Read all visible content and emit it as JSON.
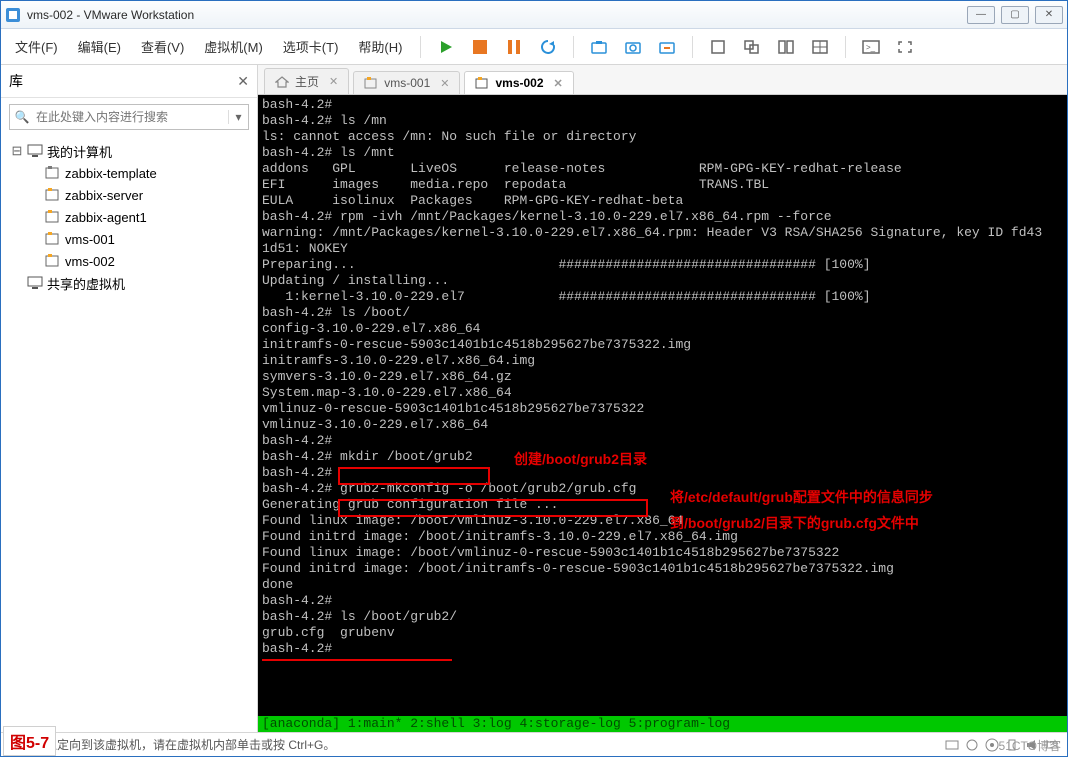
{
  "window": {
    "title": "vms-002 - VMware Workstation"
  },
  "menu": {
    "file": "文件(F)",
    "edit": "编辑(E)",
    "view": "查看(V)",
    "vm": "虚拟机(M)",
    "tabs": "选项卡(T)",
    "help": "帮助(H)"
  },
  "sidebar": {
    "lib_title": "库",
    "search_placeholder": "在此处键入内容进行搜索",
    "root": "我的计算机",
    "items": [
      {
        "label": "zabbix-template",
        "state": "off"
      },
      {
        "label": "zabbix-server",
        "state": "on"
      },
      {
        "label": "zabbix-agent1",
        "state": "on"
      },
      {
        "label": "vms-001",
        "state": "on"
      },
      {
        "label": "vms-002",
        "state": "on"
      }
    ],
    "shared": "共享的虚拟机"
  },
  "tabs": {
    "home": "主页",
    "t1": "vms-001",
    "t2": "vms-002"
  },
  "terminal": {
    "body": "bash-4.2#\nbash-4.2# ls /mn\nls: cannot access /mn: No such file or directory\nbash-4.2# ls /mnt\naddons   GPL       LiveOS      release-notes            RPM-GPG-KEY-redhat-release\nEFI      images    media.repo  repodata                 TRANS.TBL\nEULA     isolinux  Packages    RPM-GPG-KEY-redhat-beta\nbash-4.2# rpm -ivh /mnt/Packages/kernel-3.10.0-229.el7.x86_64.rpm --force\nwarning: /mnt/Packages/kernel-3.10.0-229.el7.x86_64.rpm: Header V3 RSA/SHA256 Signature, key ID fd43\n1d51: NOKEY\nPreparing...                          ################################# [100%]\nUpdating / installing...\n   1:kernel-3.10.0-229.el7            ################################# [100%]\nbash-4.2# ls /boot/\nconfig-3.10.0-229.el7.x86_64\ninitramfs-0-rescue-5903c1401b1c4518b295627be7375322.img\ninitramfs-3.10.0-229.el7.x86_64.img\nsymvers-3.10.0-229.el7.x86_64.gz\nSystem.map-3.10.0-229.el7.x86_64\nvmlinuz-0-rescue-5903c1401b1c4518b295627be7375322\nvmlinuz-3.10.0-229.el7.x86_64\nbash-4.2#\nbash-4.2# mkdir /boot/grub2\nbash-4.2#\nbash-4.2# grub2-mkconfig -o /boot/grub2/grub.cfg\nGenerating grub configuration file ...\nFound linux image: /boot/vmlinuz-3.10.0-229.el7.x86_64\nFound initrd image: /boot/initramfs-3.10.0-229.el7.x86_64.img\nFound linux image: /boot/vmlinuz-0-rescue-5903c1401b1c4518b295627be7375322\nFound initrd image: /boot/initramfs-0-rescue-5903c1401b1c4518b295627be7375322.img\ndone\nbash-4.2#\nbash-4.2# ls /boot/grub2/\ngrub.cfg  grubenv\nbash-4.2#",
    "status": "[anaconda] 1:main* 2:shell  3:log  4:storage-log  5:program-log"
  },
  "annotations": {
    "label1": "创建/boot/grub2目录",
    "label2a": "将/etc/default/grub配置文件中的信息同步",
    "label2b": "到/boot/grub2/目录下的grub.cfg文件中",
    "fig": "图5-7"
  },
  "bottom": {
    "hint": "要将输入定向到该虚拟机，请在虚拟机内部单击或按 Ctrl+G。"
  },
  "watermark": "51CTO博客"
}
